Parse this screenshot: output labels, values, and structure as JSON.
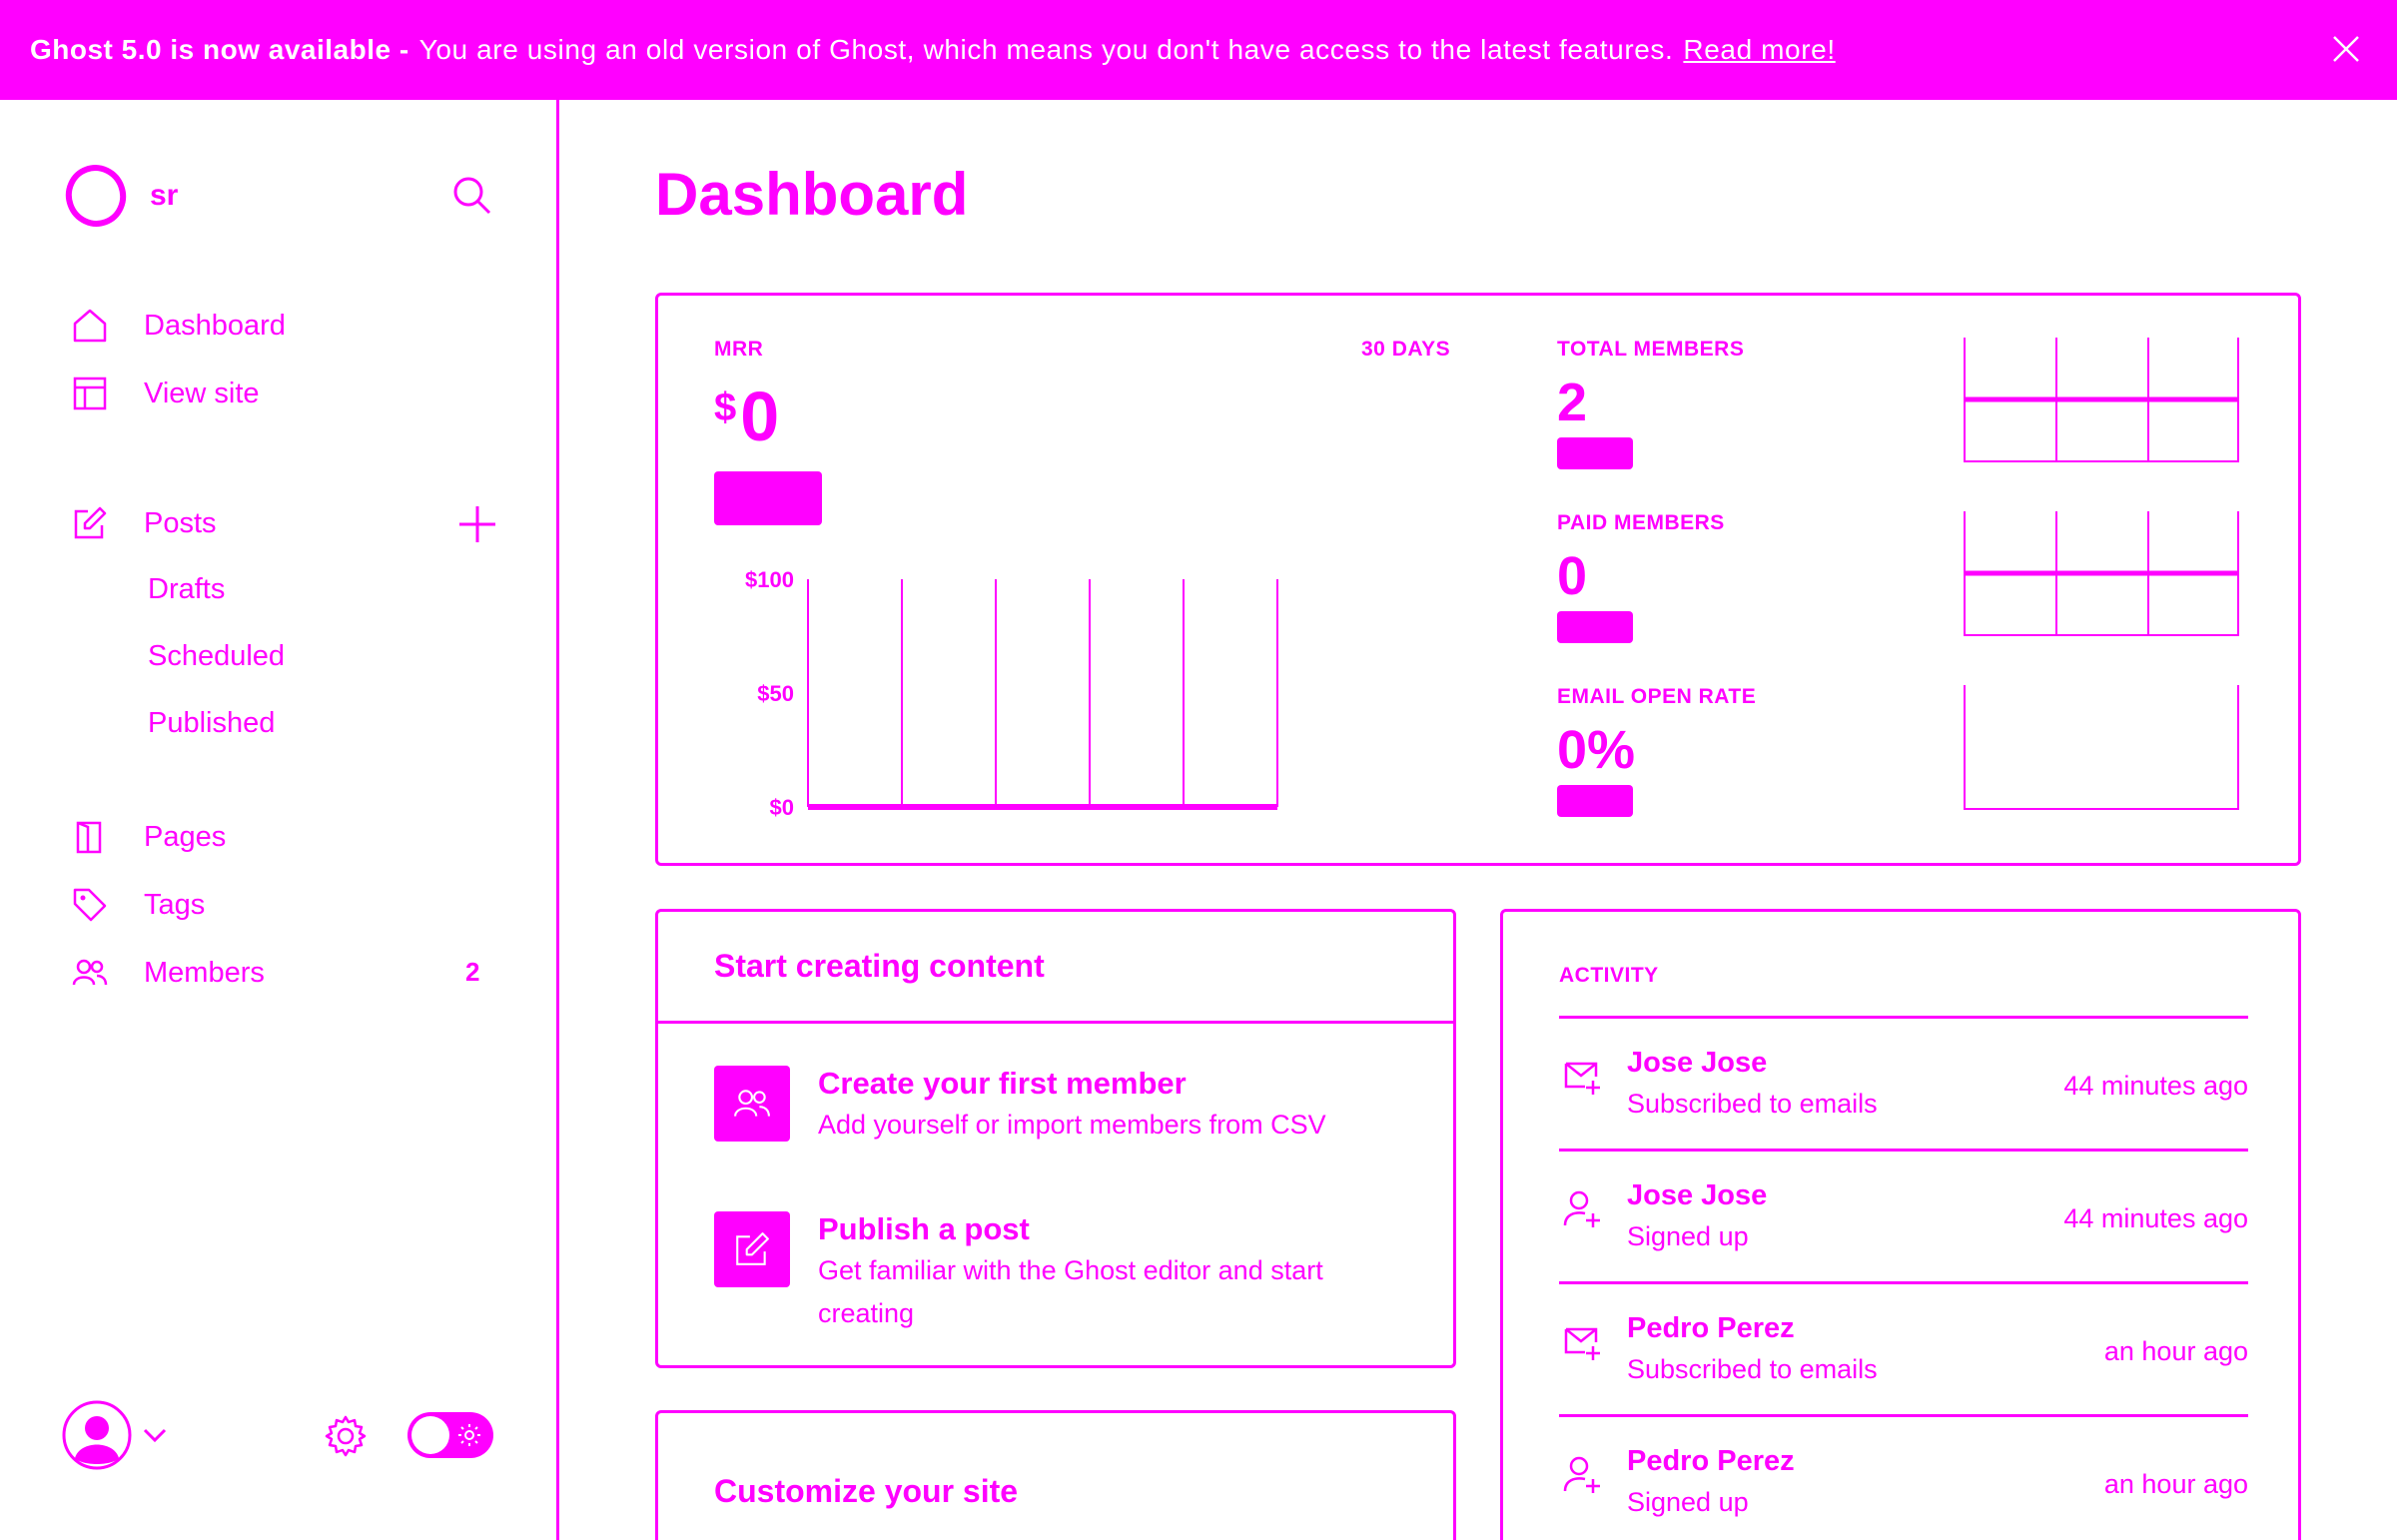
{
  "banner": {
    "strong": "Ghost 5.0 is now available -",
    "text": "You are using an old version of Ghost, which means you don't have access to the latest features.",
    "link": "Read more!"
  },
  "sidebar": {
    "site_name": "sr",
    "nav": [
      {
        "label": "Dashboard",
        "icon": "home-icon"
      },
      {
        "label": "View site",
        "icon": "layout-icon"
      }
    ],
    "posts": {
      "label": "Posts",
      "sub": [
        "Drafts",
        "Scheduled",
        "Published"
      ]
    },
    "nav2": [
      {
        "label": "Pages",
        "icon": "pages-icon"
      },
      {
        "label": "Tags",
        "icon": "tag-icon"
      },
      {
        "label": "Members",
        "icon": "members-icon",
        "count": "2"
      }
    ]
  },
  "main": {
    "title": "Dashboard",
    "stats": {
      "mrr_label": "MRR",
      "range_label": "30 DAYS",
      "mrr_currency": "$",
      "mrr_value": "0",
      "total_members_label": "TOTAL MEMBERS",
      "total_members_value": "2",
      "paid_members_label": "PAID MEMBERS",
      "paid_members_value": "0",
      "email_open_rate_label": "EMAIL OPEN RATE",
      "email_open_rate_value": "0%"
    },
    "start_creating": {
      "title": "Start creating content",
      "items": [
        {
          "title": "Create your first member",
          "desc": "Add yourself or import members from CSV"
        },
        {
          "title": "Publish a post",
          "desc": "Get familiar with the Ghost editor and start creating"
        }
      ]
    },
    "customize": {
      "title": "Customize your site"
    },
    "activity": {
      "label": "ACTIVITY",
      "rows": [
        {
          "name": "Jose Jose",
          "desc": "Subscribed to emails",
          "time": "44 minutes ago",
          "icon": "mail-plus-icon"
        },
        {
          "name": "Jose Jose",
          "desc": "Signed up",
          "time": "44 minutes ago",
          "icon": "user-plus-icon"
        },
        {
          "name": "Pedro Perez",
          "desc": "Subscribed to emails",
          "time": "an hour ago",
          "icon": "mail-plus-icon"
        },
        {
          "name": "Pedro Perez",
          "desc": "Signed up",
          "time": "an hour ago",
          "icon": "user-plus-icon"
        }
      ]
    }
  },
  "colors": {
    "accent": "#ff00ff",
    "background": "#ffffff"
  },
  "chart_data": {
    "type": "line",
    "title": "MRR",
    "ylim": [
      0,
      100
    ],
    "y_ticks": [
      "$100",
      "$50",
      "$0"
    ],
    "x": [
      1,
      2,
      3,
      4,
      5,
      6
    ],
    "series": [
      {
        "values": [
          0,
          0,
          0,
          0,
          0,
          0
        ]
      }
    ],
    "grid": true
  }
}
